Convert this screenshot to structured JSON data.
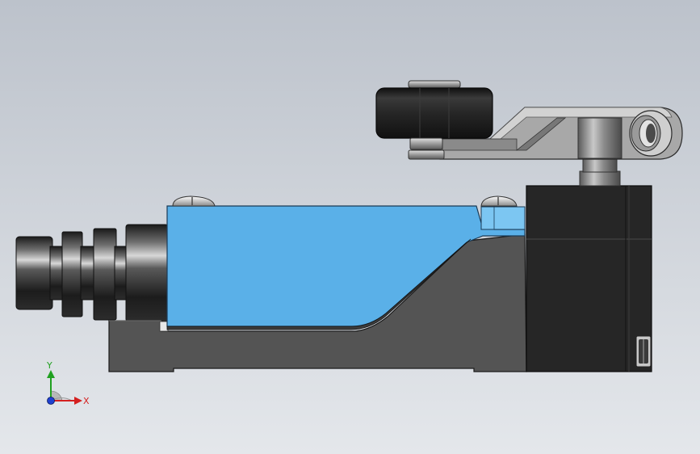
{
  "viewport": {
    "background_top": "#bcc2cb",
    "background_bottom": "#e4e7eb"
  },
  "model": {
    "blue_cover_color": "#5ab0e8",
    "base_color": "#545454",
    "dark_block_color": "#262626",
    "arm_color": "#a8a8a8"
  },
  "triad": {
    "x_label": "X",
    "y_label": "Y",
    "x_color": "#d42020",
    "y_color": "#20a020",
    "z_color": "#2040d0"
  }
}
